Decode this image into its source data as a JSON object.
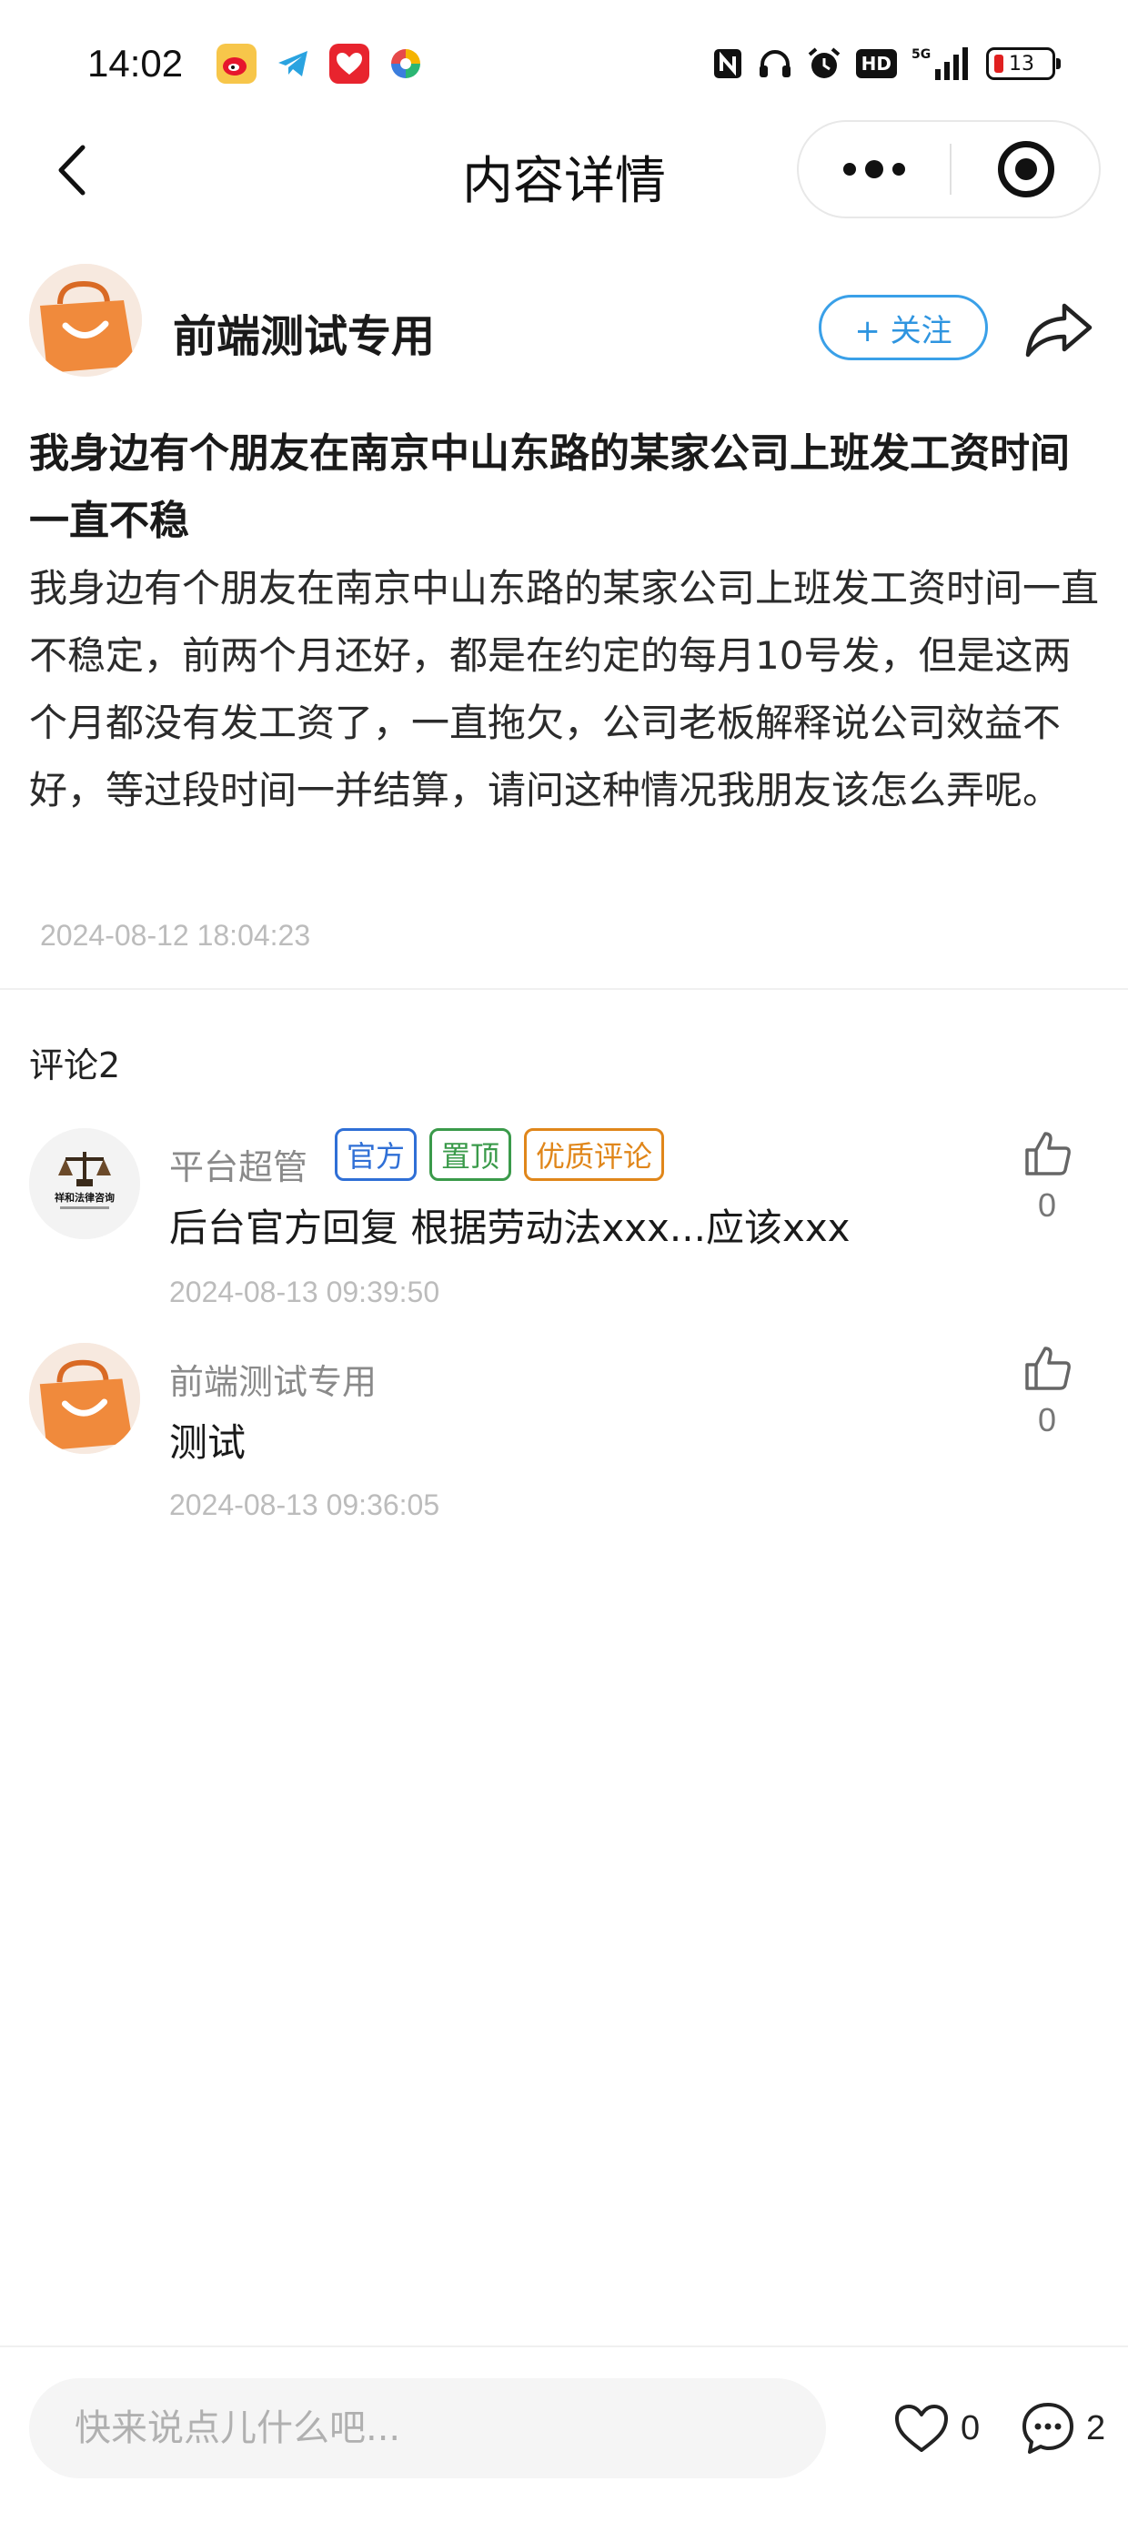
{
  "status_bar": {
    "time": "14:02",
    "battery_level": "13",
    "network_label": "5G",
    "hd_label": "HD",
    "app_icons": [
      "weibo-icon",
      "telegram-icon",
      "app-icon",
      "colorful-app-icon"
    ],
    "system_icons": [
      "nfc-icon",
      "headphones-icon",
      "alarm-icon",
      "hd-icon",
      "signal-icon",
      "battery-icon"
    ]
  },
  "nav": {
    "title": "内容详情",
    "back_icon": "chevron-left-icon",
    "more_icon": "more-dots-icon",
    "close_icon": "target-circle-icon"
  },
  "post": {
    "author": "前端测试专用",
    "follow_label": "+ 关注",
    "share_icon": "share-icon",
    "title": "我身边有个朋友在南京中山东路的某家公司上班发工资时间一直不稳",
    "body": "我身边有个朋友在南京中山东路的某家公司上班发工资时间一直不稳定，前两个月还好，都是在约定的每月10号发，但是这两个月都没有发工资了，一直拖欠，公司老板解释说公司效益不好，等过段时间一并结算，请问这种情况我朋友该怎么弄呢。",
    "time": "2024-08-12 18:04:23"
  },
  "comments_header": "评论2",
  "comments": [
    {
      "user": "平台超管",
      "tags": [
        "官方",
        "置顶",
        "优质评论"
      ],
      "text": "后台官方回复 根据劳动法xxx...应该xxx",
      "time": "2024-08-13 09:39:50",
      "likes": "0",
      "avatar_text": "祥和法律咨询"
    },
    {
      "user": "前端测试专用",
      "tags": [],
      "text": "测试",
      "time": "2024-08-13 09:36:05",
      "likes": "0"
    }
  ],
  "bottom_bar": {
    "input_placeholder": "快来说点儿什么吧...",
    "like_count": "0",
    "comment_count": "2"
  },
  "colors": {
    "accent_blue": "#3aa0e8",
    "brand_orange": "#f08a3c",
    "tag_blue": "#2f6fd6",
    "tag_green": "#3a9a4a",
    "tag_orange": "#e0861a"
  }
}
